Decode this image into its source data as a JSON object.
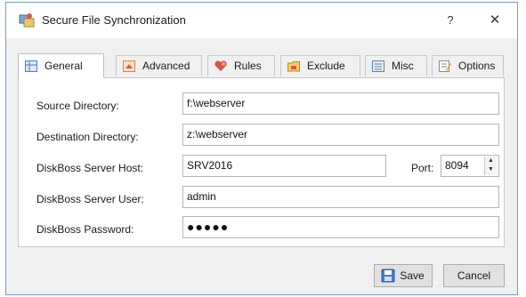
{
  "window": {
    "title": "Secure File Synchronization",
    "help_label": "?",
    "close_label": "✕",
    "accent": "#6f9bd6"
  },
  "tabs": [
    {
      "label": "General",
      "icon": "general-grid-icon",
      "active": true
    },
    {
      "label": "Advanced",
      "icon": "advanced-icon",
      "active": false
    },
    {
      "label": "Rules",
      "icon": "rules-heart-icon",
      "active": false
    },
    {
      "label": "Exclude",
      "icon": "exclude-folder-icon",
      "active": false
    },
    {
      "label": "Misc",
      "icon": "misc-list-icon",
      "active": false
    },
    {
      "label": "Options",
      "icon": "options-edit-icon",
      "active": false
    }
  ],
  "form": {
    "source": {
      "label": "Source Directory:",
      "value": "f:\\webserver"
    },
    "destination": {
      "label": "Destination Directory:",
      "value": "z:\\webserver"
    },
    "host": {
      "label": "DiskBoss Server Host:",
      "value": "SRV2016"
    },
    "port": {
      "label": "Port:",
      "value": "8094"
    },
    "user": {
      "label": "DiskBoss Server User:",
      "value": "admin"
    },
    "password": {
      "label": "DiskBoss Password:",
      "value": "●●●●●"
    }
  },
  "buttons": {
    "save_label": "Save",
    "cancel_label": "Cancel"
  }
}
